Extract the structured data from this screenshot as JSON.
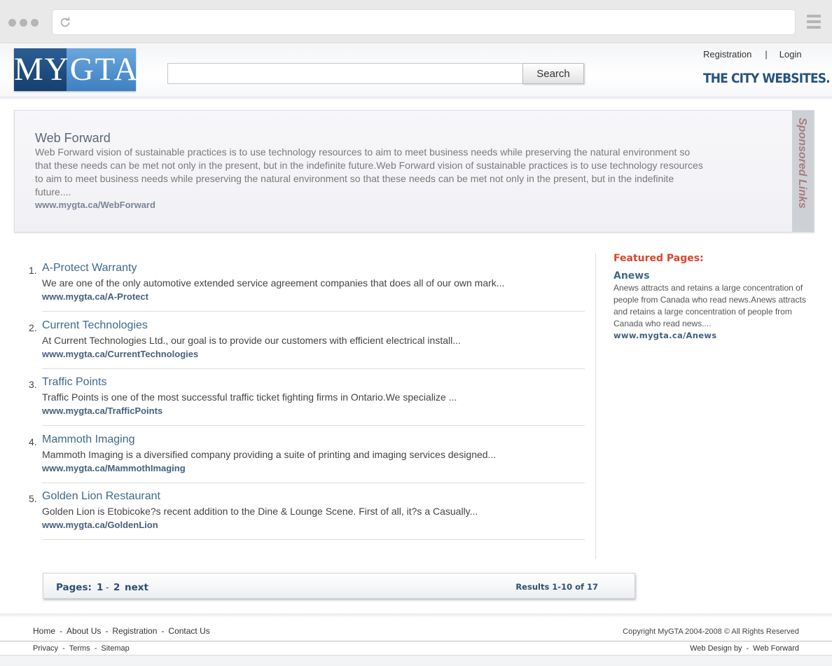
{
  "browser": {
    "menu_icon": "hamburger-icon",
    "reload_icon": "reload-icon"
  },
  "header": {
    "logo_text": "MYGTA",
    "search": {
      "value": "",
      "button_label": "Search"
    },
    "links": {
      "registration": "Registration",
      "separator": "|",
      "login": "Login"
    },
    "tagline": "THE CITY WEBSITES."
  },
  "sponsored": {
    "title": "Web Forward",
    "description": "Web Forward vision of sustainable practices is to use technology resources to aim to meet business needs while preserving the natural environment so that these needs can be met not only in the present, but in the indefinite future.Web Forward vision of sustainable practices is to use technology resources to aim to meet business needs while preserving the natural environment so that these needs can be met not only in the present, but in the indefinite future....",
    "url": "www.mygta.ca/WebForward",
    "side_label": "Sponsored Links"
  },
  "results": [
    {
      "number": "1.",
      "title": "A-Protect Warranty",
      "description": "We are one of the only automotive extended service agreement companies that does all of our own mark...",
      "url": "www.mygta.ca/A-Protect"
    },
    {
      "number": "2.",
      "title": "Current Technologies",
      "description": "At Current Technologies Ltd., our goal is to provide our customers with efficient electrical install...",
      "url": "www.mygta.ca/CurrentTechnologies"
    },
    {
      "number": "3.",
      "title": "Traffic Points",
      "description": "Traffic Points is one of the most successful traffic ticket fighting firms in Ontario.We specialize ...",
      "url": "www.mygta.ca/TrafficPoints"
    },
    {
      "number": "4.",
      "title": "Mammoth Imaging",
      "description": "Mammoth Imaging is a diversified company providing a suite of printing and imaging services designed...",
      "url": "www.mygta.ca/MammothImaging"
    },
    {
      "number": "5.",
      "title": "Golden Lion Restaurant",
      "description": "Golden Lion is Etobicoke?s recent addition to the Dine & Lounge Scene. First of all, it?s a Casually...",
      "url": "www.mygta.ca/GoldenLion"
    }
  ],
  "featured": {
    "heading": "Featured Pages:",
    "title": "Anews",
    "description": "Anews attracts and retains a large concentration of people from Canada who read news.Anews attracts and retains a large concentration of people from Canada who read news....",
    "url": "www.mygta.ca/Anews"
  },
  "pager": {
    "label": "Pages:",
    "page1": "1",
    "dash": "-",
    "page2": "2",
    "next": "next",
    "results_text": "Results 1-10 of 17"
  },
  "footer": {
    "nav": [
      "Home",
      "About Us",
      "Registration",
      "Contact Us"
    ],
    "separator": "-",
    "copyright": "Copyright MyGTA 2004-2008 © All Rights Reserved",
    "sub": [
      "Privacy",
      "Terms",
      "Sitemap"
    ],
    "credit_label": "Web Design by",
    "credit_link": "Web Forward"
  }
}
